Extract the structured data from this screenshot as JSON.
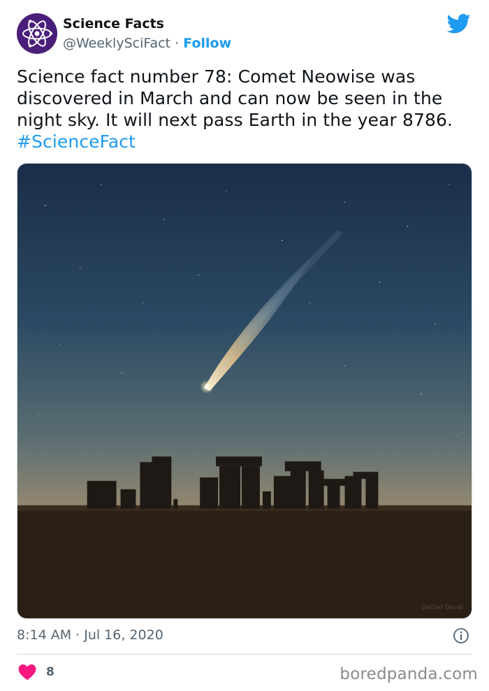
{
  "tweet": {
    "author_name": "Science Facts",
    "author_handle": "@WeeklySciFact",
    "separator": "·",
    "follow_label": "Follow",
    "text": "Science fact number 78: Comet Neowise was discovered in March and can now be seen in the night sky. It will next pass Earth in the year 8786.",
    "hashtag": "#ScienceFact",
    "timestamp": "8:14 AM · Jul 16, 2020",
    "like_count": "8",
    "photo_credit": "Declan Deval"
  },
  "icons": {
    "avatar": "atom-icon",
    "platform": "twitter-bird-icon",
    "info": "info-icon",
    "like": "heart-icon"
  },
  "colors": {
    "link": "#1d9bf0",
    "like": "#f91880",
    "avatar_bg": "#4a1f7a",
    "muted": "#536471"
  },
  "watermark": "boredpanda.com"
}
